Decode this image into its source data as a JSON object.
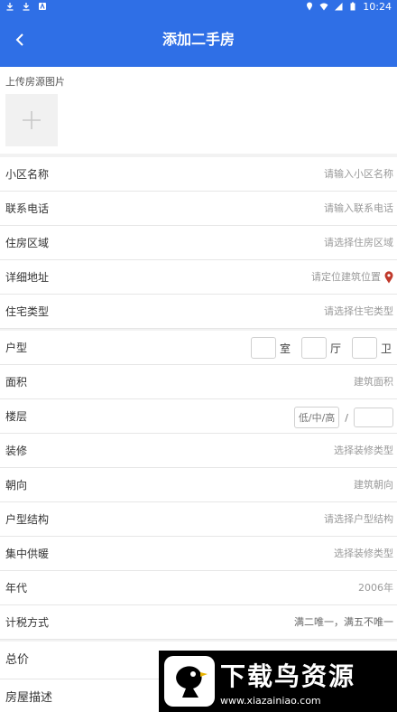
{
  "status_bar": {
    "time": "10:24"
  },
  "header": {
    "title": "添加二手房"
  },
  "upload": {
    "label": "上传房源图片"
  },
  "form": {
    "community": {
      "label": "小区名称",
      "placeholder": "请输入小区名称"
    },
    "phone": {
      "label": "联系电话",
      "placeholder": "请输入联系电话"
    },
    "area_region": {
      "label": "住房区域",
      "placeholder": "请选择住房区域"
    },
    "address": {
      "label": "详细地址",
      "placeholder": "请定位建筑位置"
    },
    "housing_type": {
      "label": "住宅类型",
      "placeholder": "请选择住宅类型"
    },
    "layout": {
      "label": "户型",
      "unit_room": "室",
      "unit_hall": "厅",
      "unit_bath": "卫"
    },
    "size": {
      "label": "面积",
      "placeholder": "建筑面积"
    },
    "floor": {
      "label": "楼层",
      "level_select": "低/中/高",
      "slash": "/"
    },
    "decoration": {
      "label": "装修",
      "placeholder": "选择装修类型"
    },
    "orientation": {
      "label": "朝向",
      "placeholder": "建筑朝向"
    },
    "structure": {
      "label": "户型结构",
      "placeholder": "请选择户型结构"
    },
    "heating": {
      "label": "集中供暖",
      "placeholder": "选择装修类型"
    },
    "year": {
      "label": "年代",
      "placeholder": "2006年"
    },
    "tax": {
      "label": "计税方式",
      "placeholder": "满二唯一，满五不唯一"
    },
    "total_price": {
      "label": "总价"
    },
    "description": {
      "label": "房屋描述"
    }
  },
  "watermark": {
    "title": "下载鸟资源",
    "url": "www.xiazainiao.com"
  },
  "colors": {
    "brand": "#2f6fe6",
    "location_pin": "#c0392b"
  }
}
